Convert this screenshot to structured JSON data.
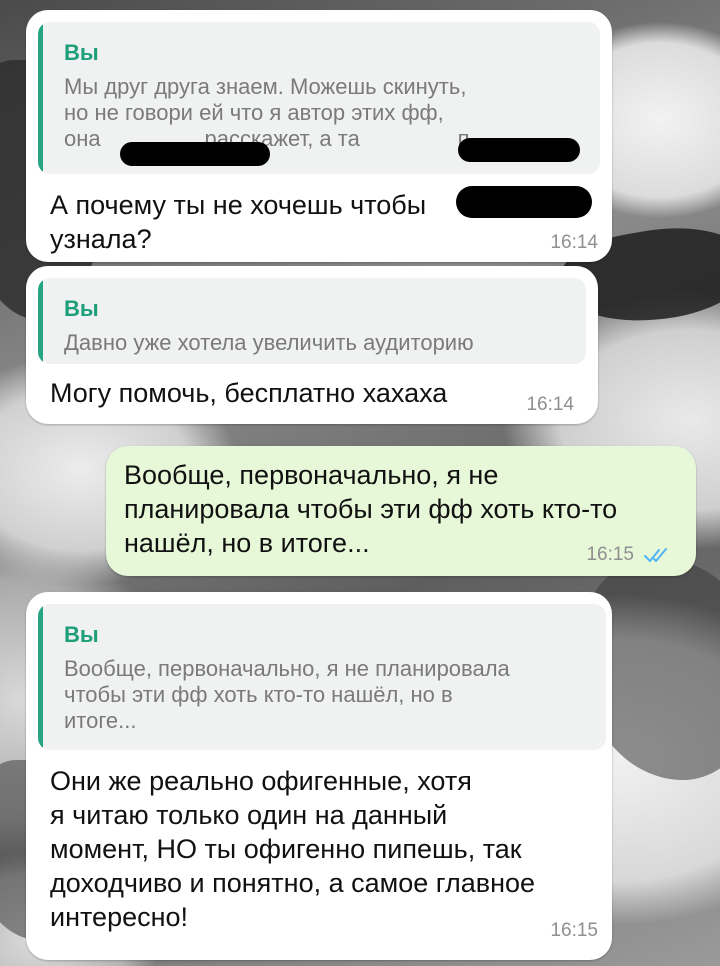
{
  "messages": [
    {
      "quote_author": "Вы",
      "quote_lines": [
        "Мы друг друга знаем. Можешь скинуть,",
        "но не говори ей что я автор этих фф,",
        "она                 расскажет, а та                п..."
      ],
      "text_lines": [
        "А почему ты не хочешь чтобы",
        "узнала?"
      ],
      "time": "16:14"
    },
    {
      "quote_author": "Вы",
      "quote_lines": [
        "Давно уже хотела увеличить аудиторию"
      ],
      "text_lines": [
        "Могу помочь, бесплатно хахаха"
      ],
      "time": "16:14"
    },
    {
      "text_lines": [
        "Вообще, первоначально, я не",
        "планировала чтобы эти фф хоть кто-то",
        "нашёл, но в итоге..."
      ],
      "time": "16:15",
      "status": "read"
    },
    {
      "quote_author": "Вы",
      "quote_lines": [
        "Вообще, первоначально, я не планировала",
        "чтобы эти фф хоть кто-то нашёл, но в",
        "итоге..."
      ],
      "text_lines": [
        "Они же реально офигенные, хотя",
        "я читаю только один на данный",
        "момент, НО ты офигенно пипешь, так",
        "доходчиво и понятно, а самое главное",
        "интересно!"
      ],
      "time": "16:15"
    }
  ],
  "colors": {
    "incoming_bubble": "#ffffff",
    "outgoing_bubble": "#e7f8d8",
    "quote_accent": "#25a583",
    "read_ticks": "#4fb3f6"
  }
}
